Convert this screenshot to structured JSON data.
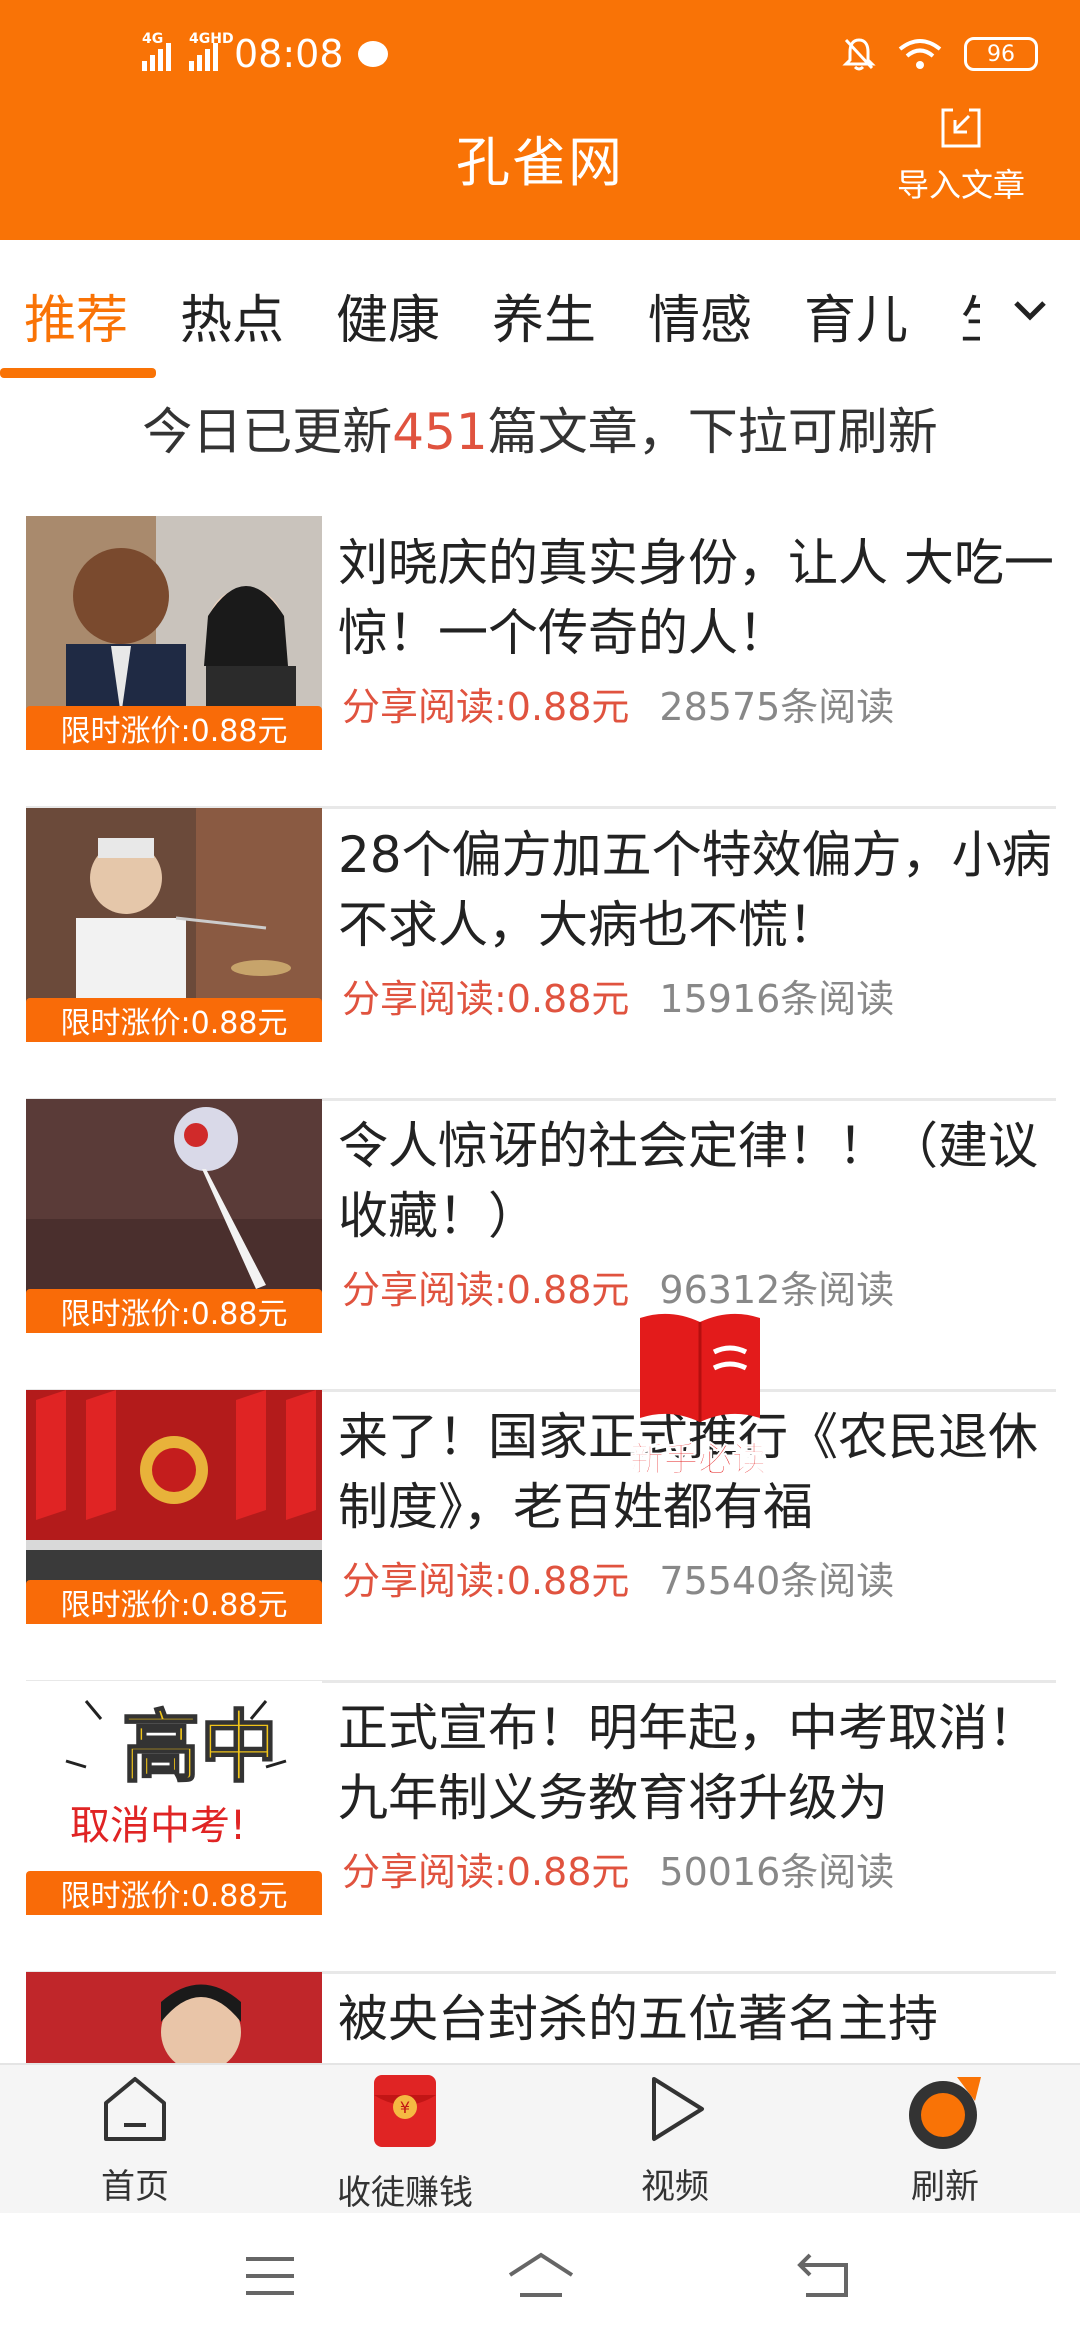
{
  "status_bar": {
    "net1": "4G",
    "net2": "4GHD",
    "time": "08:08",
    "battery": "96"
  },
  "header": {
    "title": "孔雀网",
    "import_label": "导入文章"
  },
  "tabs": [
    {
      "label": "推荐",
      "active": true
    },
    {
      "label": "热点"
    },
    {
      "label": "健康"
    },
    {
      "label": "养生"
    },
    {
      "label": "情感"
    },
    {
      "label": "育儿"
    },
    {
      "label": "生"
    }
  ],
  "update_bar": {
    "prefix": "今日已更新",
    "count": "451",
    "suffix": "篇文章，下拉可刷新"
  },
  "articles": [
    {
      "title": "刘晓庆的真实身份，让人 大吃一惊！一个传奇的人！",
      "price_tag": "限时涨价:0.88元",
      "share": "分享阅读:0.88元",
      "reads": "28575条阅读"
    },
    {
      "title": "28个偏方加五个特效偏方，小病不求人，大病也不慌！",
      "price_tag": "限时涨价:0.88元",
      "share": "分享阅读:0.88元",
      "reads": "15916条阅读"
    },
    {
      "title": "令人惊讶的社会定律！！（建议收藏！）",
      "price_tag": "限时涨价:0.88元",
      "share": "分享阅读:0.88元",
      "reads": "96312条阅读"
    },
    {
      "title": "来了！国家正式推行《农民退休制度》，老百姓都有福",
      "price_tag": "限时涨价:0.88元",
      "share": "分享阅读:0.88元",
      "reads": "75540条阅读"
    },
    {
      "title": "正式宣布！明年起，中考取消！九年制义务教育将升级为",
      "price_tag": "限时涨价:0.88元",
      "share": "分享阅读:0.88元",
      "reads": "50016条阅读",
      "thumb_text1": "高中",
      "thumb_text2": "取消中考!"
    },
    {
      "title": "被央台封杀的五位著名主持",
      "price_tag": "",
      "share": "",
      "reads": ""
    }
  ],
  "floating_badge": {
    "label": "新手必读"
  },
  "bottom_nav": [
    {
      "label": "首页",
      "icon": "home-icon"
    },
    {
      "label": "收徒赚钱",
      "icon": "red-envelope-icon"
    },
    {
      "label": "视频",
      "icon": "play-icon"
    },
    {
      "label": "刷新",
      "icon": "refresh-icon"
    }
  ],
  "colors": {
    "brand": "#f97306",
    "accent_red": "#e0533f",
    "price_tag": "#f96b08"
  }
}
